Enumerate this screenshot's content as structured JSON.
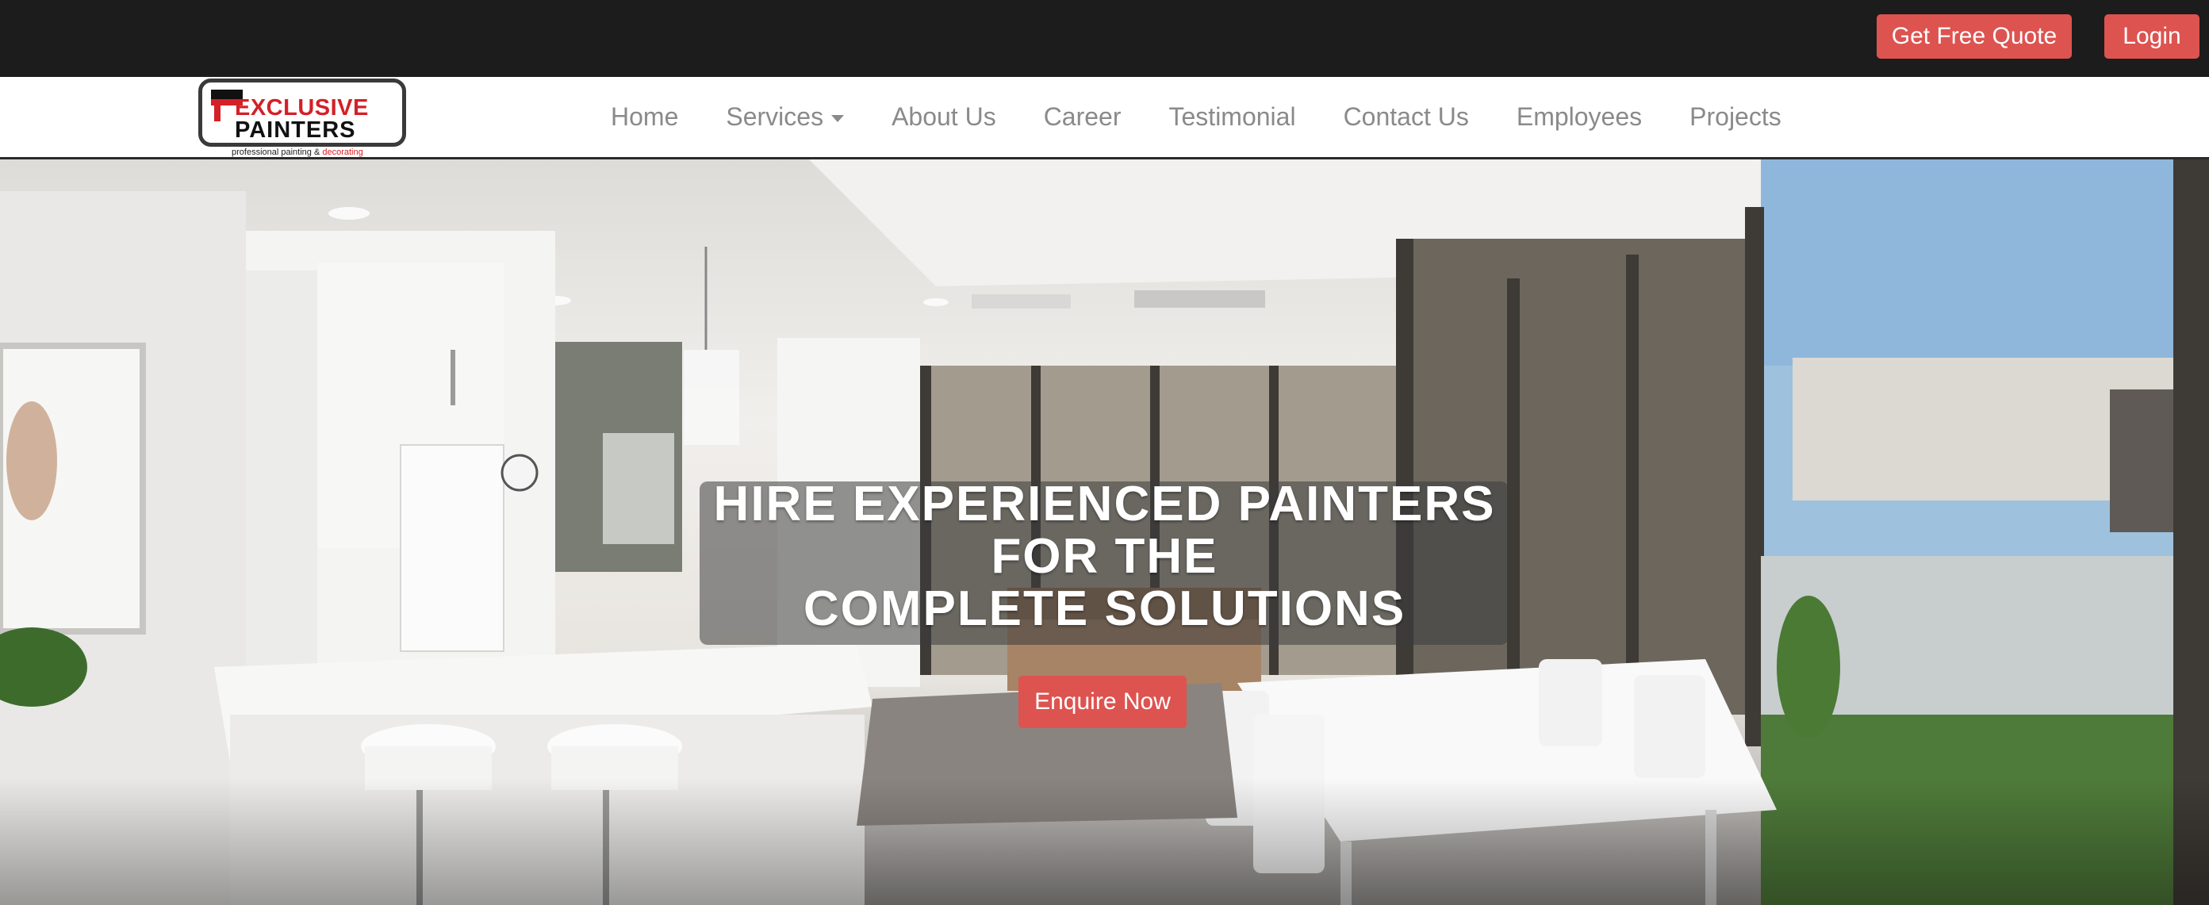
{
  "topbar": {
    "quote_button": "Get Free Quote",
    "login_button": "Login"
  },
  "logo": {
    "line1": "EXCLUSIVE",
    "line2": "PAINTERS",
    "tagline_main": "professional painting & ",
    "tagline_accent": "decorating"
  },
  "nav": {
    "items": [
      {
        "label": "Home"
      },
      {
        "label": "Services"
      },
      {
        "label": "About Us"
      },
      {
        "label": "Career"
      },
      {
        "label": "Testimonial"
      },
      {
        "label": "Contact Us"
      },
      {
        "label": "Employees"
      },
      {
        "label": "Projects"
      }
    ]
  },
  "hero": {
    "headline_line1": "HIRE EXPERIENCED PAINTERS",
    "headline_line2": "FOR THE",
    "headline_line3": "COMPLETE SOLUTIONS",
    "cta": "Enquire Now"
  },
  "colors": {
    "topbar_bg": "#1c1c1c",
    "accent_red": "#dd5350",
    "nav_text": "#8a8a8a"
  }
}
